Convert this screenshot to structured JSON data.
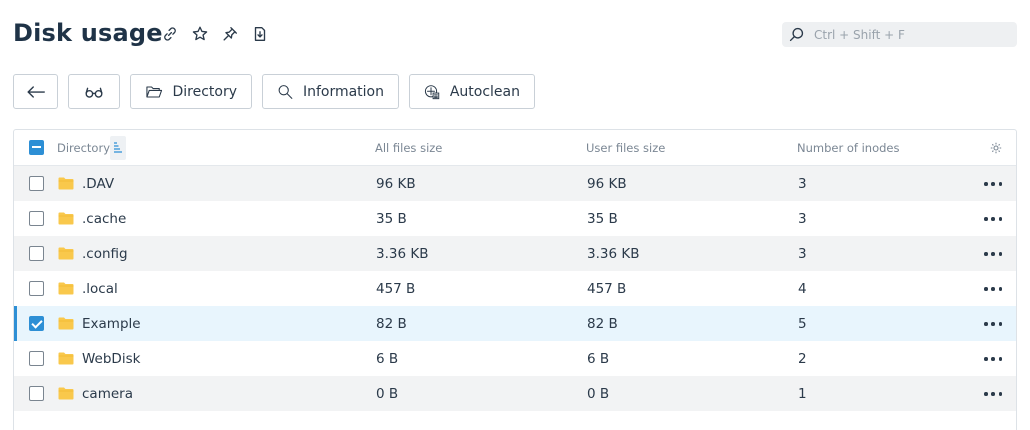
{
  "header": {
    "title": "Disk usage",
    "icons": [
      "link-icon",
      "star-icon",
      "pin-icon",
      "download-icon"
    ]
  },
  "search": {
    "placeholder": "Ctrl + Shift + F",
    "value": ""
  },
  "toolbar": {
    "back_icon": "arrow-left-icon",
    "view_icon": "glasses-icon",
    "directory_label": "Directory",
    "information_label": "Information",
    "autoclean_label": "Autoclean"
  },
  "table": {
    "columns": {
      "directory": "Directory",
      "all_files_size": "All files size",
      "user_files_size": "User files size",
      "inodes": "Number of inodes"
    },
    "header_checkbox": "partial",
    "sort_column": "directory",
    "rows": [
      {
        "name": ".DAV",
        "all_size": "96 KB",
        "user_size": "96 KB",
        "inodes": "3",
        "checked": false
      },
      {
        "name": ".cache",
        "all_size": "35 B",
        "user_size": "35 B",
        "inodes": "3",
        "checked": false
      },
      {
        "name": ".config",
        "all_size": "3.36 KB",
        "user_size": "3.36 KB",
        "inodes": "3",
        "checked": false
      },
      {
        "name": ".local",
        "all_size": "457 B",
        "user_size": "457 B",
        "inodes": "4",
        "checked": false
      },
      {
        "name": "Example",
        "all_size": "82 B",
        "user_size": "82 B",
        "inodes": "5",
        "checked": true
      },
      {
        "name": "WebDisk",
        "all_size": "6 B",
        "user_size": "6 B",
        "inodes": "2",
        "checked": false
      },
      {
        "name": "camera",
        "all_size": "0 B",
        "user_size": "0 B",
        "inodes": "1",
        "checked": false
      }
    ]
  },
  "colors": {
    "accent": "#2d8fd5",
    "folder": "#f9c84c",
    "row_alt": "#f2f3f4",
    "row_selected": "#e8f5fd"
  }
}
